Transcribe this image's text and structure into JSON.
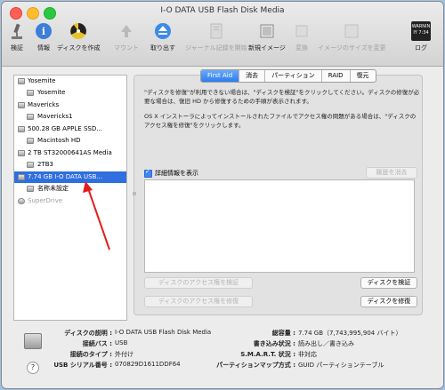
{
  "window": {
    "title": "I-O DATA USB Flash Disk Media"
  },
  "toolbar": {
    "verify": "検証",
    "info": "情報",
    "burn": "ディスクを作成",
    "mount": "マウント",
    "eject": "取り出す",
    "journal": "ジャーナル記録を開始",
    "newimage": "新規イメージ",
    "convert": "変換",
    "resize": "イメージのサイズを変更",
    "log": "ログ",
    "log_badge_top": "WARNIN",
    "log_badge_bottom": "IY 7:34"
  },
  "sidebar": {
    "items": [
      {
        "label": "Yosemite"
      },
      {
        "label": "Yosemite"
      },
      {
        "label": "Mavericks"
      },
      {
        "label": "Mavericks1"
      },
      {
        "label": "500.28 GB APPLE SSD..."
      },
      {
        "label": "Macintosh HD"
      },
      {
        "label": "2 TB ST32000641AS Media"
      },
      {
        "label": "2TB3"
      },
      {
        "label": "7.74 GB I-O DATA USB..."
      },
      {
        "label": "名称未設定"
      },
      {
        "label": "SuperDrive"
      }
    ]
  },
  "tabs": [
    "First Aid",
    "消去",
    "パーティション",
    "RAID",
    "復元"
  ],
  "firstaid": {
    "para1": "\"ディスクを修復\"が利用できない場合は、\"ディスクを検証\"をクリックしてください。ディスクの修復が必要な場合は、復旧 HD から修復するための手順が表示されます。",
    "para2": "OS X インストーラによってインストールされたファイルでアクセス権の問題がある場合は、\"ディスクのアクセス権を修復\"をクリックします。",
    "show_details": "詳細情報を表示",
    "clear_history": "履歴を消去",
    "verify_perms": "ディスクのアクセス権を検証",
    "repair_perms": "ディスクのアクセス権を修復",
    "verify_disk": "ディスクを検証",
    "repair_disk": "ディスクを修復"
  },
  "info": {
    "desc_label": "ディスクの説明 :",
    "desc_value": "I-O DATA USB Flash Disk Media",
    "bus_label": "接続バス :",
    "bus_value": "USB",
    "type_label": "接続のタイプ :",
    "type_value": "外付け",
    "serial_label": "USB シリアル番号 :",
    "serial_value": "070829D1611DDF64",
    "cap_label": "総容量 :",
    "cap_value": "7.74 GB（7,743,995,904 バイト）",
    "rw_label": "書き込み状況 :",
    "rw_value": "読み出し／書き込み",
    "smart_label": "S.M.A.R.T. 状況 :",
    "smart_value": "非対応",
    "map_label": "パーティションマップ方式 :",
    "map_value": "GUID パーティションテーブル",
    "help": "?"
  },
  "colors": {
    "selection": "#2f6fde",
    "annotation": "#e51c1c"
  }
}
